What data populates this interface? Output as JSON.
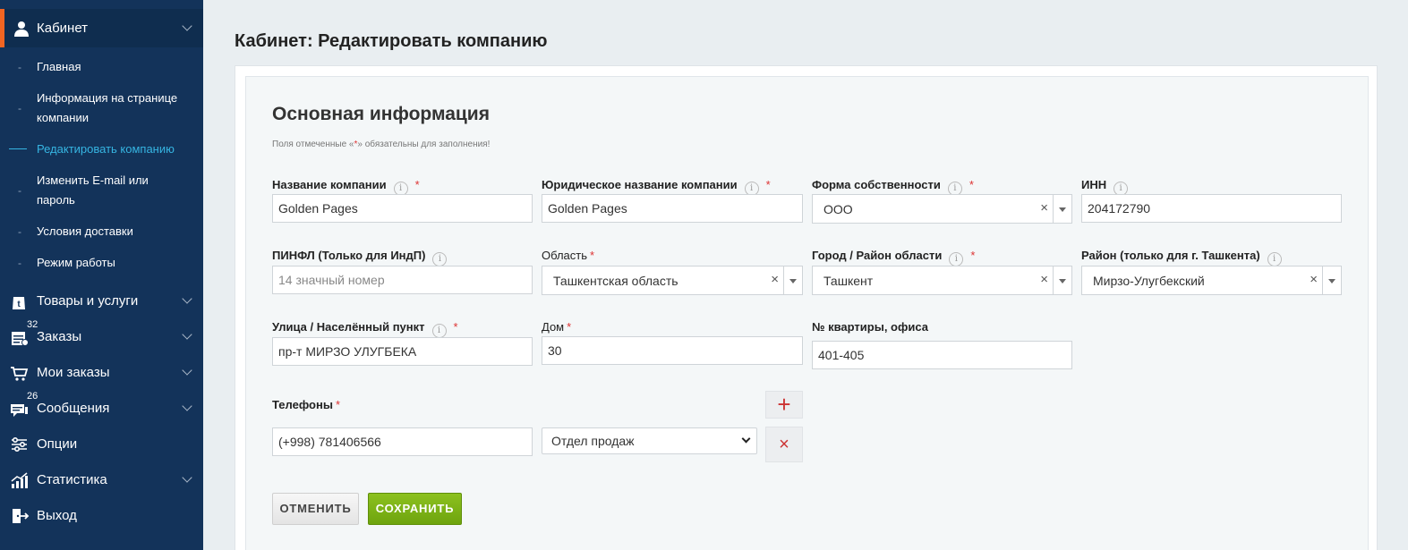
{
  "sidebar": {
    "cabinet": {
      "label": "Кабинет",
      "icon": "user-icon"
    },
    "subitems": [
      {
        "label": "Главная"
      },
      {
        "label": "Информация на странице компании"
      },
      {
        "label": "Редактировать компанию"
      },
      {
        "label": "Изменить E-mail или пароль"
      },
      {
        "label": "Условия доставки"
      },
      {
        "label": "Режим работы"
      }
    ],
    "items": [
      {
        "label": "Товары и услуги",
        "icon": "shopping-bag-icon",
        "count": ""
      },
      {
        "label": "Заказы",
        "icon": "orders-icon",
        "count": "32"
      },
      {
        "label": "Мои заказы",
        "icon": "cart-icon",
        "count": ""
      },
      {
        "label": "Сообщения",
        "icon": "messages-icon",
        "count": "26"
      },
      {
        "label": "Опции",
        "icon": "sliders-icon",
        "count": ""
      },
      {
        "label": "Статистика",
        "icon": "chart-icon",
        "count": ""
      },
      {
        "label": "Выход",
        "icon": "logout-icon",
        "count": ""
      }
    ]
  },
  "page": {
    "title": "Кабинет: Редактировать компанию"
  },
  "form": {
    "section_title": "Основная информация",
    "hint_prefix": "Поля отмеченные «",
    "hint_star": "*",
    "hint_suffix": "» обязательны для заполнения!",
    "required_mark": "*",
    "info_mark": "i",
    "clear_mark": "×",
    "company_name": {
      "label": "Название компании",
      "value": "Golden Pages"
    },
    "legal_name": {
      "label": "Юридическое название компании",
      "value": "Golden Pages"
    },
    "ownership": {
      "label": "Форма собственности",
      "value": "ООО"
    },
    "inn": {
      "label": "ИНН",
      "value": "204172790"
    },
    "pinfl": {
      "label": "ПИНФЛ (Только для ИндП)",
      "placeholder": "14 значный номер"
    },
    "region": {
      "label": "Область",
      "value": "Ташкентская область"
    },
    "city": {
      "label": "Город / Район области",
      "value": "Ташкент"
    },
    "district": {
      "label": "Район (только для г. Ташкента)",
      "value": "Мирзо-Улугбекский"
    },
    "street": {
      "label": "Улица / Населённый пункт",
      "value": "пр-т МИРЗО УЛУГБЕКА"
    },
    "house": {
      "label": "Дом",
      "value": "30"
    },
    "apartment": {
      "label": "№ квартиры, офиса",
      "value": "401-405"
    },
    "phones": {
      "label": "Телефоны",
      "value": "(+998) 781406566",
      "type": "Отдел продаж",
      "add": "+",
      "remove": "×"
    },
    "cancel_label": "ОТМЕНИТЬ",
    "save_label": "СОХРАНИТЬ"
  },
  "colors": {
    "accent": "#f26522",
    "sidebar_bg": "#13335a",
    "active_link": "#36b5e2",
    "save_green": "#7ab317",
    "required": "#dd3333"
  }
}
